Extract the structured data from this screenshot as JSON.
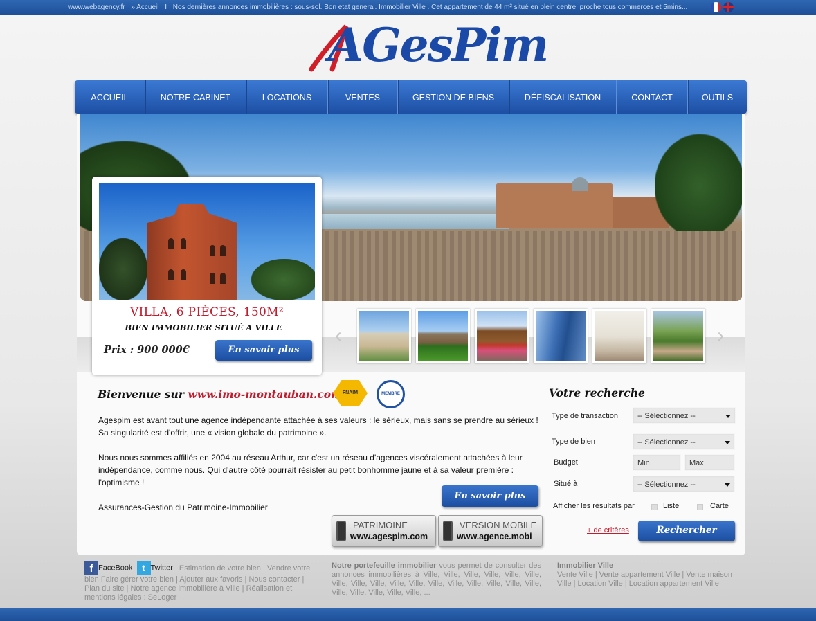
{
  "topbar": {
    "site": "www.webagency.fr",
    "breadcrumb": "» Accueil",
    "separator": "I",
    "ticker": "Nos dernières annonces immobilières : sous-sol. Bon etat general. Immobilier Ville . Cet appartement de 44 m² situé en plein centre, proche tous commerces et 5mins..."
  },
  "logo": {
    "text": "AGesPim",
    "brand_color": "#1a49a8",
    "accent_color": "#d11f2a"
  },
  "nav": {
    "items": [
      "ACCUEIL",
      "NOTRE CABINET",
      "LOCATIONS",
      "VENTES",
      "GESTION DE BIENS",
      "DÉFISCALISATION",
      "CONTACT",
      "OUTILS"
    ]
  },
  "feature": {
    "title": "VILLA, 6 PIÈCES, 150M²",
    "subtitle": "BIEN IMMOBILIER SITUÉ A VILLE",
    "price": "Prix : 900 000€",
    "button": "En savoir plus"
  },
  "carousel": {
    "prev_icon": "chevron-left-icon",
    "next_icon": "chevron-right-icon",
    "prev_glyph": "‹",
    "next_glyph": "›"
  },
  "welcome": {
    "prefix": "Bienvenue sur",
    "site": "www.imo-montauban.com",
    "paragraph1": "Agespim est avant tout une agence indépendante attachée à ses valeurs : le sérieux, mais sans se prendre au sérieux ! Sa singularité est d'offrir, une « vision globale du patrimoine ».",
    "paragraph2": "Nous nous sommes affiliés en 2004 au réseau Arthur, car c'est un réseau d'agences viscéralement attachées à leur indépendance, comme nous. Qui d'autre côté pourrait résister au petit bonhomme jaune et à sa valeur première : l'optimisme !",
    "paragraph3": "Assurances-Gestion du Patrimoine-Immobilier",
    "button": "En savoir plus",
    "badge_fnaim": "FNAIM",
    "badge_membre": "MEMBRE"
  },
  "mobile": {
    "patrimoine_label": "PATRIMOINE",
    "patrimoine_url": "www.agespim.com",
    "mobile_label": "VERSION MOBILE",
    "mobile_url": "www.agence.mobi"
  },
  "search": {
    "title": "Votre recherche",
    "transaction_label": "Type de transaction",
    "transaction_value": "-- Sélectionnez --",
    "bien_label": "Type de bien",
    "bien_value": "-- Sélectionnez --",
    "budget_label": "Budget",
    "min_placeholder": "Min",
    "max_placeholder": "Max",
    "situe_label": "Situé à",
    "situe_value": "-- Sélectionnez --",
    "afficher_label": "Afficher les résultats par",
    "liste_label": "Liste",
    "carte_label": "Carte",
    "plus_criteres": "+ de critères",
    "submit": "Rechercher"
  },
  "footer": {
    "facebook": "FaceBook",
    "twitter": "Twitter",
    "col1_text": "| Estimation de votre bien | Vendre votre bien Faire gérer votre bien | Ajouter aux favoris | Nous contacter | Plan du site | Notre agence immobilière à Ville | Réalisation et mentions légales : SeLoger",
    "col2_title": "Notre portefeuille immobilier",
    "col2_text": "vous permet de consulter des annonces immobilières à Ville, Ville, Ville, Ville, Ville, Ville, Ville, Ville, Ville, Ville, Ville, Ville, Ville, Ville, Ville, Ville, Ville, Ville, Ville, Ville, Ville, Ville, ...",
    "col3_title": "Immobilier Ville",
    "col3_text": "Vente Ville | Vente appartement Ville | Vente maison Ville | Location Ville | Location appartement Ville"
  }
}
